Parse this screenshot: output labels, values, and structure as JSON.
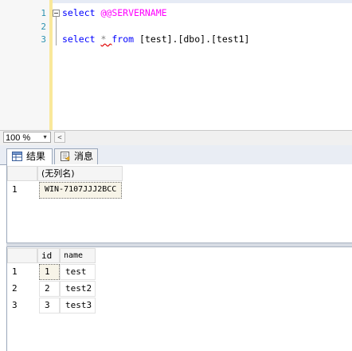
{
  "editor": {
    "line_numbers": [
      "1",
      "2",
      "3"
    ],
    "line1": {
      "kw": "select",
      "sysvar": "@@SERVERNAME"
    },
    "line3": {
      "kw_select": "select",
      "star": "*",
      "kw_from": "from",
      "table": "[test].[dbo].[test1]"
    }
  },
  "zoom": {
    "value": "100 %"
  },
  "tabs": {
    "results": "结果",
    "messages": "消息"
  },
  "grid1": {
    "columns": [
      "(无列名)"
    ],
    "rows": [
      {
        "num": "1",
        "cells": [
          "WIN-7107JJJ2BCC"
        ]
      }
    ]
  },
  "grid2": {
    "columns": [
      "id",
      "name"
    ],
    "rows": [
      {
        "num": "1",
        "cells": [
          "1",
          "test"
        ]
      },
      {
        "num": "2",
        "cells": [
          "2",
          "test2"
        ]
      },
      {
        "num": "3",
        "cells": [
          "3",
          "test3"
        ]
      }
    ]
  },
  "colors": {
    "keyword": "#0000ff",
    "system_variable": "#ff00ff",
    "line_number": "#2b91af",
    "tab_border": "#9aa7ba"
  }
}
